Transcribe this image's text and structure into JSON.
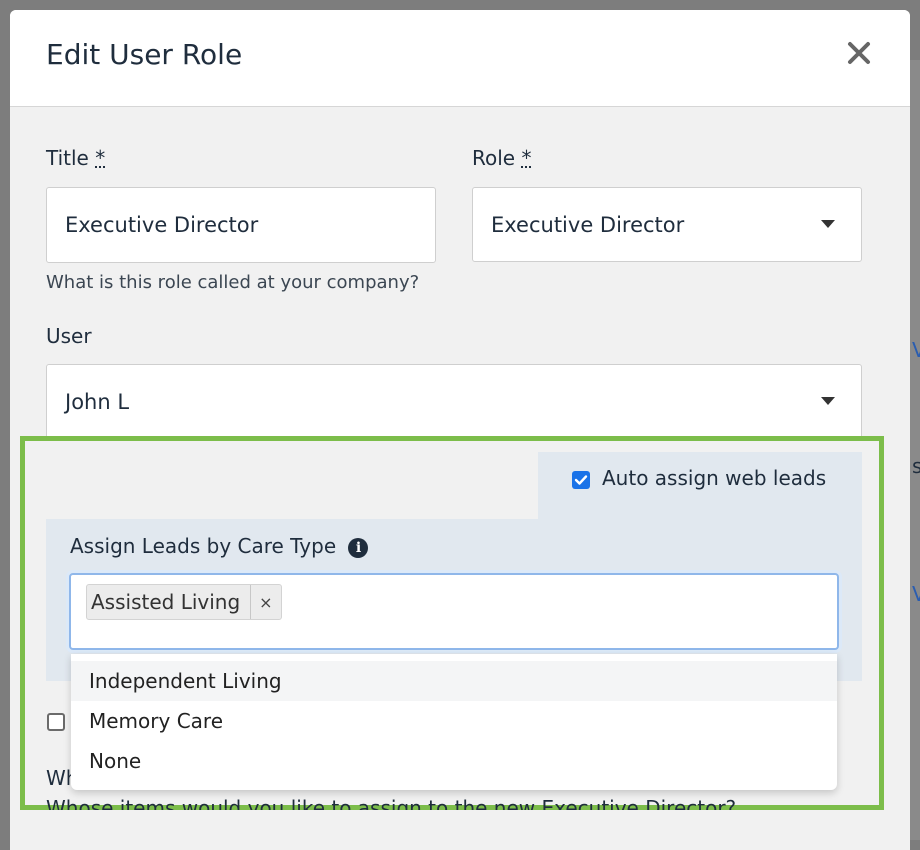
{
  "modal": {
    "title": "Edit User Role",
    "close_icon": "close-icon"
  },
  "title_field": {
    "label": "Title",
    "required_mark": "*",
    "value": "Executive Director",
    "help": "What is this role called at your company?"
  },
  "role_field": {
    "label": "Role",
    "required_mark": "*",
    "value": "Executive Director"
  },
  "user_field": {
    "label": "User",
    "value": "John L"
  },
  "auto_assign": {
    "label": "Auto assign web leads",
    "checked": true
  },
  "care_type": {
    "label": "Assign Leads by Care Type",
    "info_icon": "i",
    "selected": [
      "Assisted Living"
    ],
    "chip_remove": "×",
    "options": [
      "Independent Living",
      "Memory Care",
      "None"
    ]
  },
  "background_peek": {
    "partial_label": "Wh",
    "partial_text": "Whose items would you like to assign to the new Executive Director?",
    "side_letter_v": "V",
    "side_letter_s": "s",
    "side_letter_v2": "V"
  },
  "colors": {
    "highlight_border": "#7cbd4a",
    "checkbox_accent": "#1a73e8",
    "panel_bg": "#e1e8ef"
  }
}
